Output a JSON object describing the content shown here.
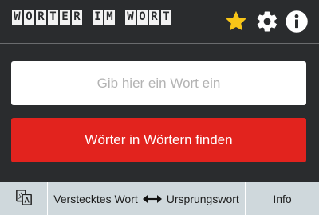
{
  "header": {
    "logo_letters": [
      "W",
      "O",
      "R",
      "T",
      "E",
      "R",
      " ",
      "I",
      "M",
      " ",
      "W",
      "O",
      "R",
      "T"
    ],
    "icons": [
      "star-icon",
      "gear-icon",
      "info-icon"
    ]
  },
  "search": {
    "placeholder": "Gib hier ein Wort ein",
    "value": ""
  },
  "find_button": {
    "label": "Wörter in Wörtern finden"
  },
  "bottom_bar": {
    "translate_icon": "translate-icon",
    "hidden_word_label": "Verstecktes Wort",
    "origin_word_label": "Ursprungswort",
    "info_label": "Info"
  },
  "colors": {
    "background": "#2a2c2e",
    "accent_red": "#e2231e",
    "star_yellow": "#f7c518",
    "bottom_bar": "#cfd8dc"
  }
}
